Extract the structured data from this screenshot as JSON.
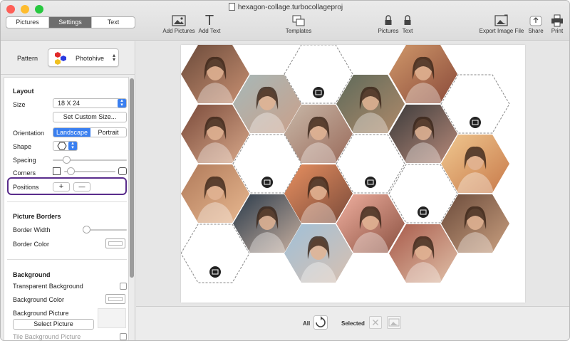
{
  "window": {
    "title": "hexagon-collage.turbocollageproj"
  },
  "tabs": [
    {
      "label": "Pictures"
    },
    {
      "label": "Settings"
    },
    {
      "label": "Text"
    }
  ],
  "toolbar": {
    "add_pictures": "Add Pictures",
    "add_text": "Add Text",
    "templates": "Templates",
    "lock_pictures": "Pictures",
    "lock_text": "Text",
    "export": "Export Image File",
    "share": "Share",
    "print": "Print"
  },
  "pattern": {
    "label": "Pattern",
    "value": "Photohive"
  },
  "layout": {
    "heading": "Layout",
    "size_label": "Size",
    "size_value": "18 X 24",
    "custom_size_button": "Set Custom Size...",
    "orientation_label": "Orientation",
    "orientation_options": [
      "Landscape",
      "Portrait"
    ],
    "orientation_selected": "Landscape",
    "shape_label": "Shape",
    "spacing_label": "Spacing",
    "corners_label": "Corners",
    "positions_label": "Positions",
    "positions_add": "+",
    "positions_remove": "—"
  },
  "borders": {
    "heading": "Picture Borders",
    "width_label": "Border Width",
    "color_label": "Border Color"
  },
  "background": {
    "heading": "Background",
    "transparent_label": "Transparent Background",
    "color_label": "Background Color",
    "picture_label": "Background Picture",
    "select_button": "Select Picture",
    "tile_label": "Tile Background Picture"
  },
  "bottom": {
    "all_label": "All",
    "selected_label": "Selected"
  },
  "colors": {
    "accent": "#3a7ff0",
    "highlight": "#5a2d8c",
    "close": "#fe5f57",
    "minimize": "#febc2e",
    "zoom": "#28c840"
  },
  "photo_tones": [
    [
      "#6b4a3a",
      "#c89072"
    ],
    [
      "#d0986a",
      "#8a4a3a"
    ],
    [
      "#a6b8b8",
      "#caa08a"
    ],
    [
      "#5e6a5a",
      "#b08a6a"
    ],
    [
      "#7a4a3a",
      "#d8a88a"
    ],
    [
      "#c8b8a8",
      "#9a6a5a"
    ],
    [
      "#3a3a3a",
      "#b88a7a"
    ],
    [
      "#f0c890",
      "#c87a4a"
    ],
    [
      "#b07a5a",
      "#e8b890"
    ],
    [
      "#e89060",
      "#7a4a3a"
    ],
    [
      "#2a3a4a",
      "#c8b0a0"
    ],
    [
      "#f0b0a0",
      "#8a5040"
    ],
    [
      "#6a4a3a",
      "#caa080"
    ],
    [
      "#a0c0d8",
      "#d8c0b0"
    ],
    [
      "#a85a4a",
      "#e0c0a8"
    ],
    [
      "#c07a5a",
      "#f0d0b0"
    ],
    [
      "#a0d0e8",
      "#c05a5a"
    ]
  ]
}
